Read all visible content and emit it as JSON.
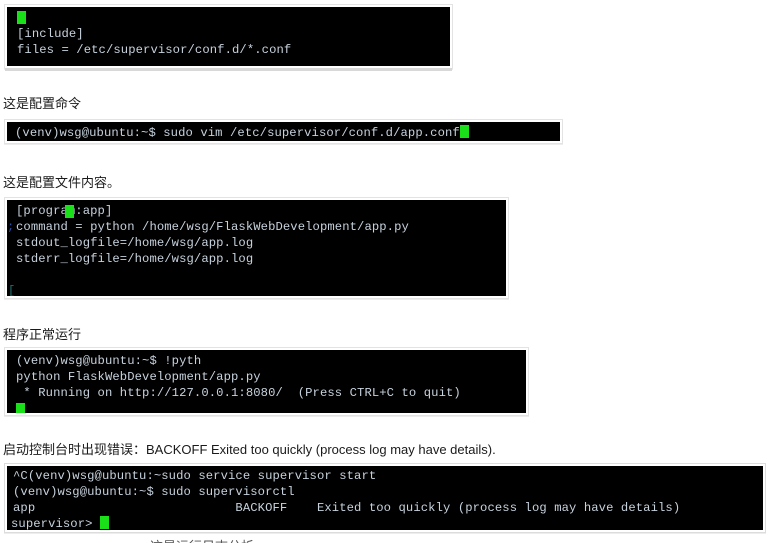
{
  "page": {
    "background": "#ffffff",
    "terminal_bg": "#000000",
    "terminal_fg": "#c7d2dd",
    "cursor_color": "#19e019",
    "frame_border": "#e3e3e3",
    "caption_color": "#1a1a1a"
  },
  "blocks": [
    {
      "id": "supervisord-include-block",
      "caption": null,
      "lines": [
        "",
        "[include]",
        "files = /etc/supervisor/conf.d/*.conf",
        ""
      ]
    },
    {
      "id": "vim-open-conf-block",
      "caption": "这是配置命令",
      "lines": [
        "(venv)wsg@ubuntu:~$ sudo vim /etc/supervisor/conf.d/app.conf"
      ]
    },
    {
      "id": "app-conf-contents-block",
      "caption": "这是配置文件内容。",
      "lines": [
        "[program:app]",
        "command = python /home/wsg/FlaskWebDevelopment/app.py",
        "",
        "stdout_logfile=/home/wsg/app.log",
        "stderr_logfile=/home/wsg/app.log",
        ""
      ],
      "gutter": [
        ";",
        "",
        "",
        "",
        "",
        ""
      ]
    },
    {
      "id": "flask-running-block",
      "caption": "程序正常运行",
      "lines": [
        "(venv)wsg@ubuntu:~$ !pyth",
        "python FlaskWebDevelopment/app.py",
        " * Running on http://127.0.0.1:8080/  (Press CTRL+C to quit)",
        ""
      ]
    },
    {
      "id": "supervisorctl-backoff-block",
      "caption": "启动控制台时出现错误：BACKOFF Exited too quickly (process log may have details).",
      "lines": [
        "^C(venv)wsg@ubuntu:~sudo service supervisor start",
        "(venv)wsg@ubuntu:~$ sudo supervisorctl",
        "app                           BACKOFF    Exited too quickly (process log may have details)",
        "supervisor> "
      ]
    }
  ]
}
